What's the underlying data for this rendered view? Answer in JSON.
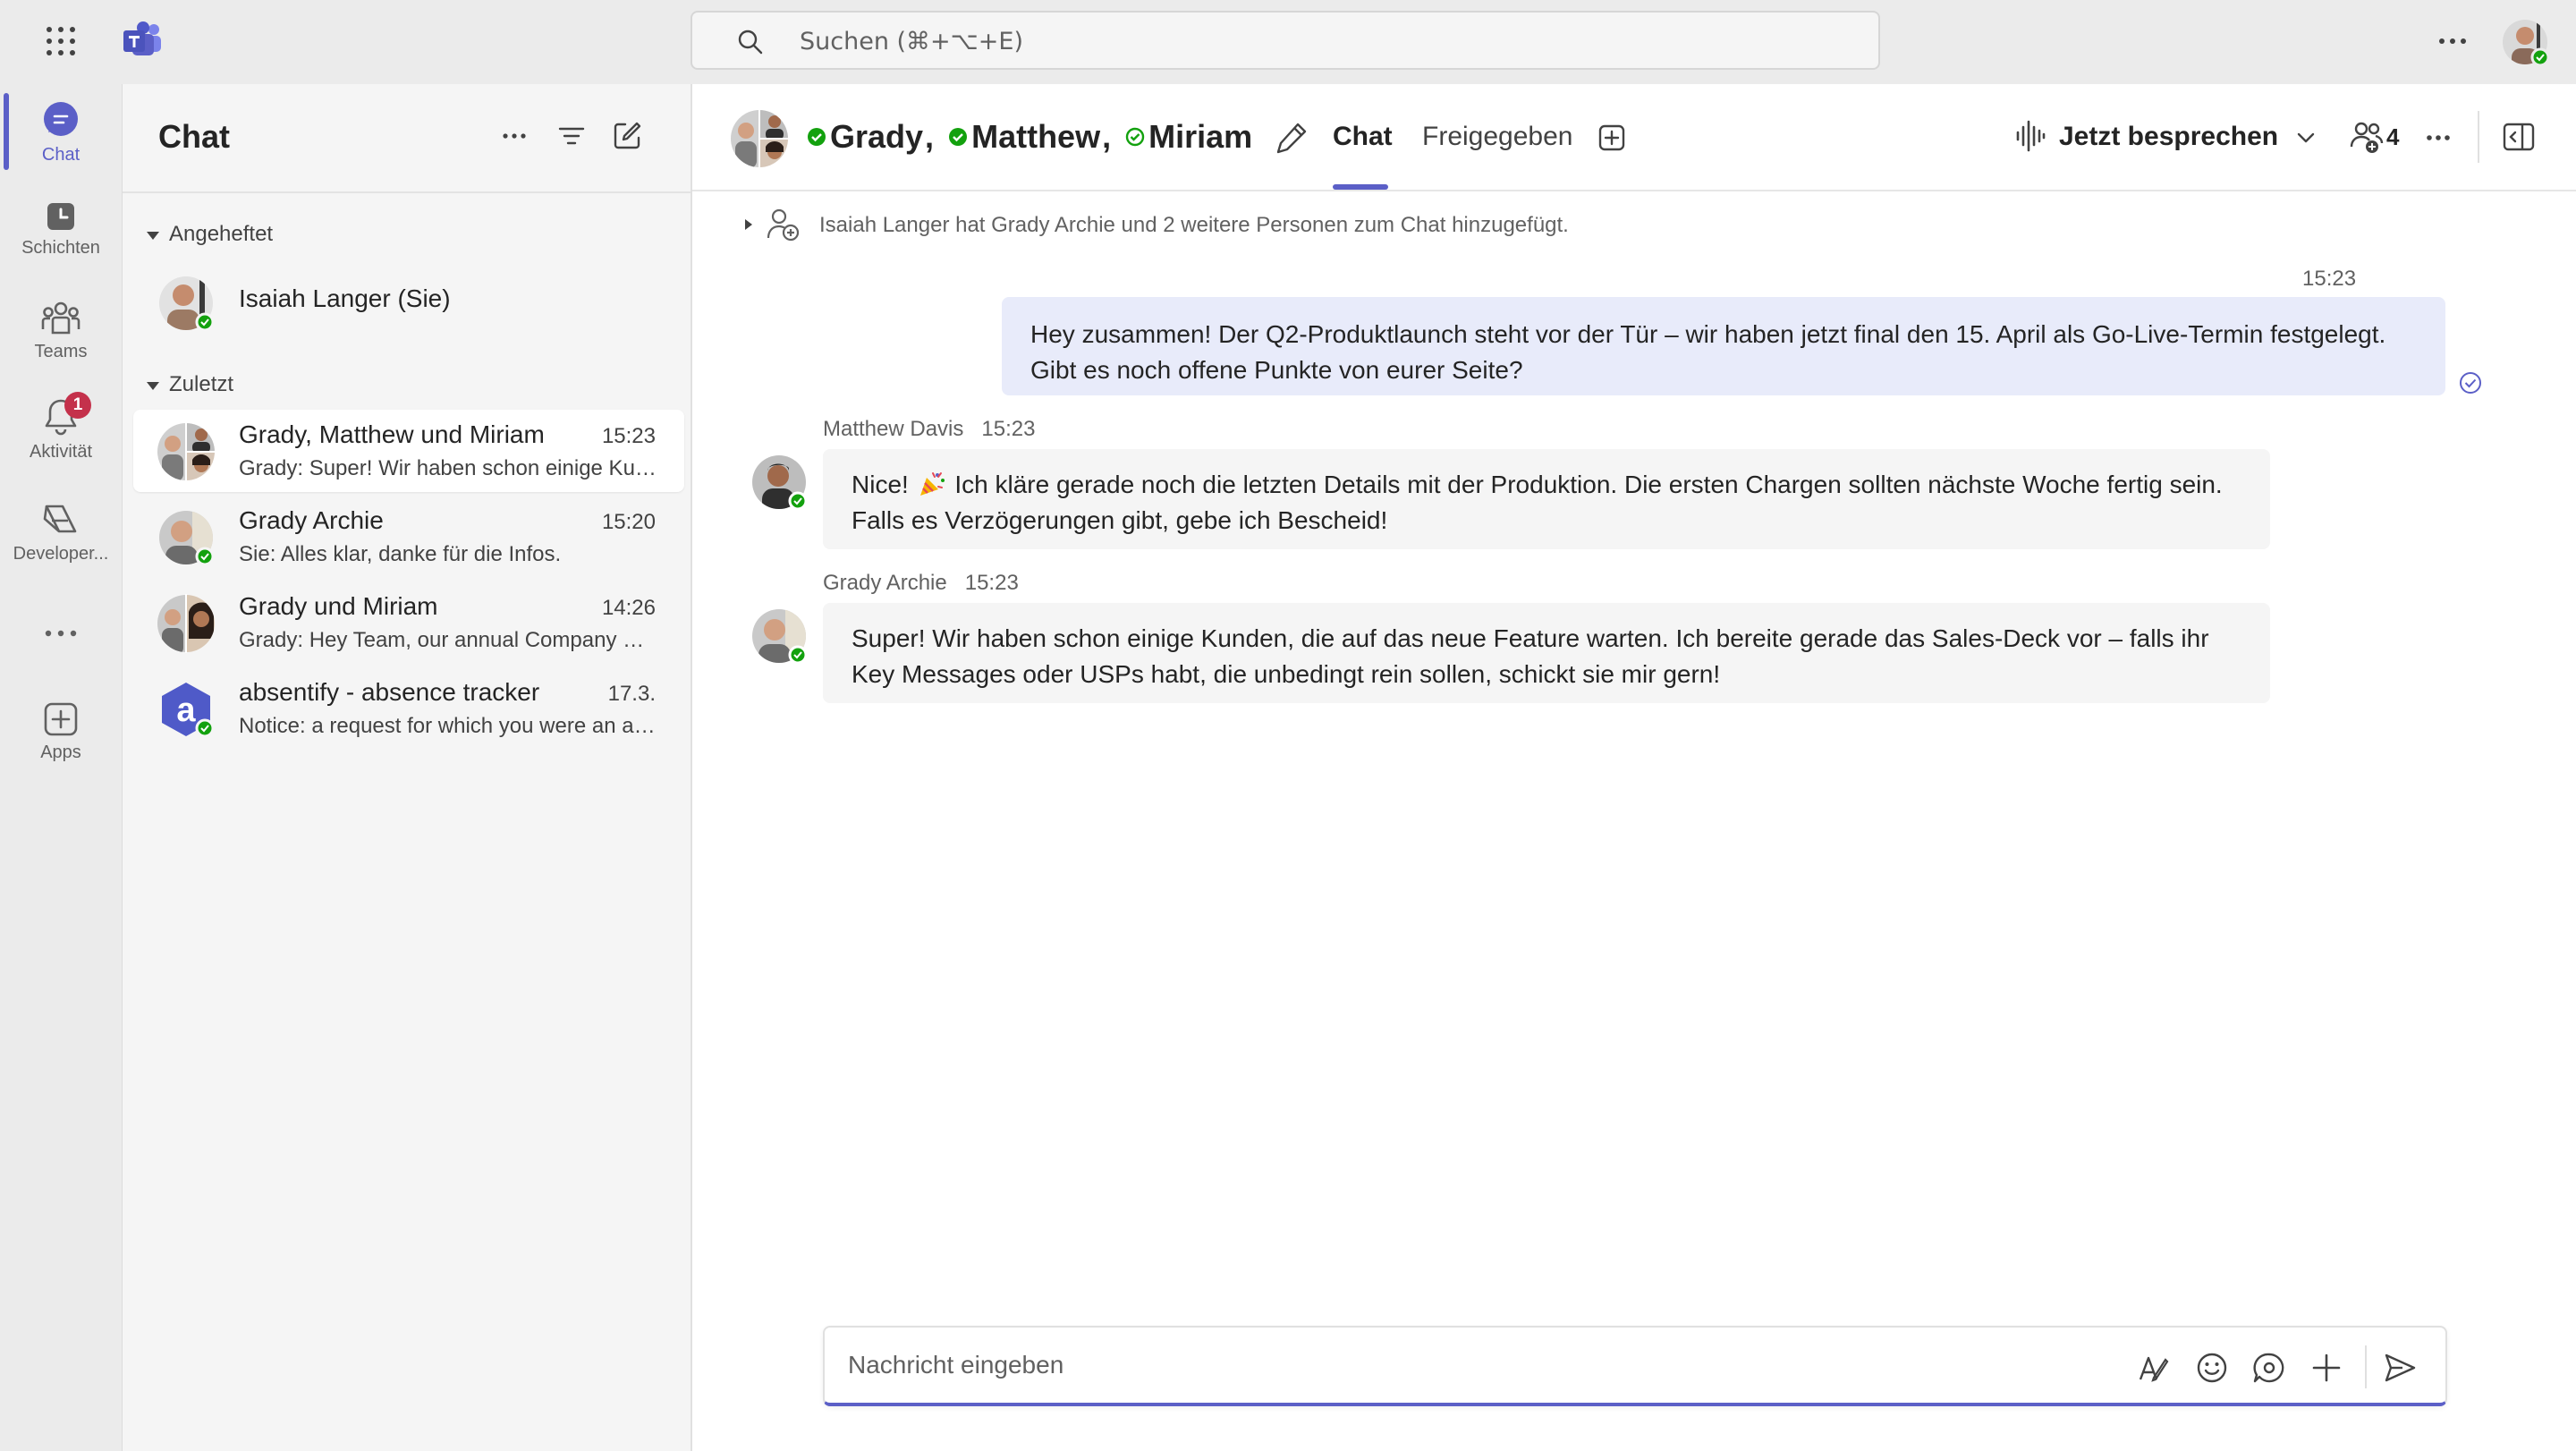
{
  "app": {
    "search_placeholder": "Suchen (⌘+⌥+E)",
    "accent_color": "#5b5fc7",
    "presence_color": "#13a10e"
  },
  "rail": {
    "items": [
      {
        "label": "Chat",
        "icon": "chat-icon",
        "active": true
      },
      {
        "label": "Schichten",
        "icon": "clock-icon"
      },
      {
        "label": "Teams",
        "icon": "teams-icon"
      },
      {
        "label": "Aktivität",
        "icon": "bell-icon",
        "badge": "1"
      },
      {
        "label": "Developer...",
        "icon": "developer-portal-icon"
      },
      {
        "label": "Apps",
        "icon": "add-app-icon"
      }
    ]
  },
  "chatlist": {
    "title": "Chat",
    "pinned_label": "Angeheftet",
    "recent_label": "Zuletzt",
    "pinned": [
      {
        "name": "Isaiah Langer (Sie)"
      }
    ],
    "recent": [
      {
        "name": "Grady, Matthew und Miriam",
        "time": "15:23",
        "preview": "Grady: Super! Wir haben schon einige Kunden, die auf das neue Feature warten."
      },
      {
        "name": "Grady Archie",
        "time": "15:20",
        "preview": "Sie: Alles klar, danke für die Infos."
      },
      {
        "name": "Grady und Miriam",
        "time": "14:26",
        "preview": "Grady: Hey Team, our annual Company Meeting is coming up"
      },
      {
        "name": "absentify - absence tracker",
        "time": "17.3.",
        "preview": "Notice: a request for which you were an approver"
      }
    ]
  },
  "conversation": {
    "participants": [
      "Grady",
      "Matthew",
      "Miriam"
    ],
    "tabs": [
      "Chat",
      "Freigegeben"
    ],
    "meet_label": "Jetzt besprechen",
    "people_count": "4",
    "system_message": "Isaiah Langer hat Grady Archie und 2 weitere Personen zum Chat hinzugefügt.",
    "messages": [
      {
        "own": true,
        "time": "15:23",
        "text": "Hey zusammen! Der Q2-Produktlaunch steht vor der Tür – wir haben jetzt final den 15. April als Go-Live-Termin festgelegt. Gibt es noch offene Punkte von eurer Seite?"
      },
      {
        "own": false,
        "author": "Matthew Davis",
        "time": "15:23",
        "text_before": "Nice!",
        "emoji": "party-popper-emoji",
        "text": "Ich kläre gerade noch die letzten Details mit der Produktion. Die ersten Chargen sollten nächste Woche fertig sein. Falls es Verzögerungen gibt, gebe ich Bescheid!"
      },
      {
        "own": false,
        "author": "Grady Archie",
        "time": "15:23",
        "text": "Super! Wir haben schon einige Kunden, die auf das neue Feature warten. Ich bereite gerade das Sales-Deck vor – falls ihr Key Messages oder USPs habt, die unbedingt rein sollen, schickt sie mir gern!"
      }
    ],
    "compose_placeholder": "Nachricht eingeben"
  }
}
